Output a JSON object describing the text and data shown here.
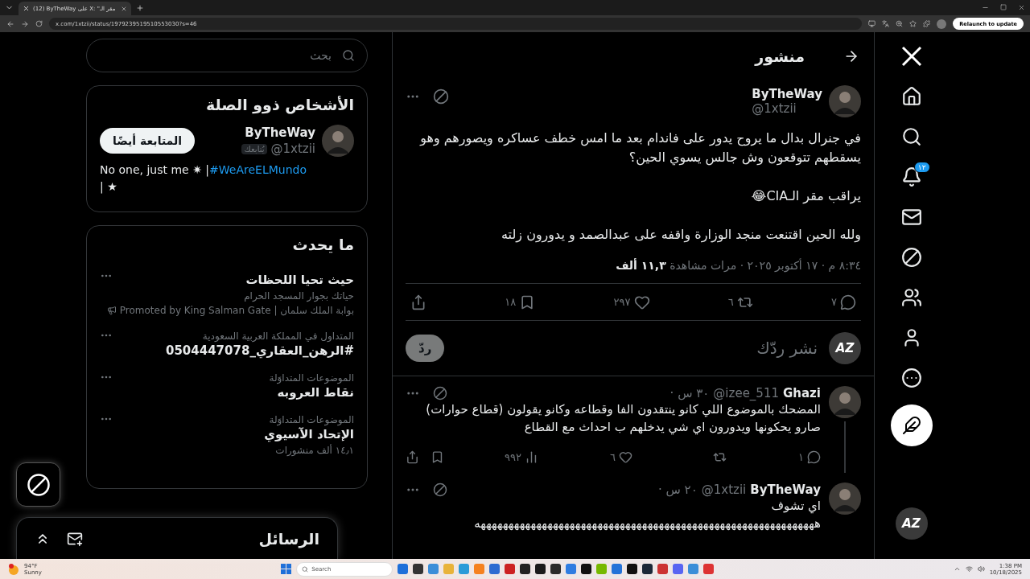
{
  "browser": {
    "tab_title": "(12) ByTheWay على X: \"مقر الـ",
    "url": "x.com/1xtzii/status/1979239519510553030?s=46",
    "update_button": "Relaunch to update"
  },
  "nav": {
    "notifications_badge": "١٢",
    "logo_text": "AZ"
  },
  "header": {
    "title": "منشور"
  },
  "post": {
    "name": "ByTheWay",
    "handle": "@1xtzii",
    "paragraphs": [
      "في جنرال بدال ما يروح يدور على فاندام بعد ما امس خطف عساكره ويصورهم وهو يسقطهم  تتوقعون وش جالس يسوي الحين؟",
      "يراقب مقر الـCIA😂",
      "ولله الحين اقتنعت منجد الوزارة واقفه على عبدالصمد و يدورون زلته"
    ],
    "meta": "٨:٣٤ م · ١٧ أكتوبر ٢٠٢٥ · مرات مشاهدة **١١,٣ ألف**",
    "actions": [
      {
        "kind": "reply",
        "count": "٧"
      },
      {
        "kind": "repost",
        "count": "٦"
      },
      {
        "kind": "like",
        "count": "٢٩٧"
      },
      {
        "kind": "bookmark",
        "count": "١٨"
      },
      {
        "kind": "share"
      }
    ]
  },
  "composer": {
    "logo_text": "AZ",
    "placeholder": "نشر ردّك",
    "button": "ردّ"
  },
  "replies": [
    {
      "name": "Ghazi",
      "handle": "@izee_511",
      "time": "· ٣٠ س",
      "thread": true,
      "lines": [
        "المضحك بالموضوع اللي كانو ينتقدون الفا وقطاعه وكانو يقولون (قطاع حوارات) صارو يحكونها ويدورون اي شي يدخلهم ب احداث مع القطاع"
      ],
      "actions": [
        {
          "kind": "reply",
          "count": "١"
        },
        {
          "kind": "repost"
        },
        {
          "kind": "like",
          "count": "٦"
        },
        {
          "kind": "views",
          "count": "٩٩٢"
        },
        {
          "kind": "bookmark"
        },
        {
          "kind": "share"
        }
      ]
    },
    {
      "name": "ByTheWay",
      "handle": "@1xtzii",
      "time": "· ٢٠ س",
      "thread": false,
      "lines": [
        "اي تشوف",
        "هههههههههههههههههههههههههههههههههههههههههههههههههههههههههههههه"
      ]
    }
  ],
  "search": {
    "placeholder": "بحث"
  },
  "related": {
    "title": "الأشخاص ذوو الصلة",
    "name": "ByTheWay",
    "handle": "@1xtzii",
    "follows_you": "يُتابعك",
    "button": "المتابعة أيضًا",
    "bio_before": "No one, just me ✷ |",
    "bio_link": "#WeAreELMundo",
    "bio_after": "| ★"
  },
  "trends": {
    "title": "ما يحدث",
    "items": [
      {
        "kind": "promoted",
        "title": "حيث تحيا اللحظات",
        "subtitle": "حياتك بجوار المسجد الحرام",
        "promoter": "بوابة الملك سلمان | Promoted by King Salman Gate"
      },
      {
        "kind": "trend",
        "context": "المتداول في المملكة العربية السعودية",
        "title": "#الرهن_العقاري_0504447078"
      },
      {
        "kind": "trend",
        "context": "الموضوعات المتداوَلة",
        "title": "نقاط العروبه"
      },
      {
        "kind": "trend",
        "context": "الموضوعات المتداوَلة",
        "title": "الإتحاد الآسيوي",
        "count": "١٤٫١ ألف منشورات"
      }
    ]
  },
  "messages": {
    "title": "الرسائل"
  },
  "taskbar": {
    "temperature": "94°F",
    "weather": "Sunny",
    "search": "Search",
    "time": "1:38 PM",
    "date": "10/18/2025"
  }
}
